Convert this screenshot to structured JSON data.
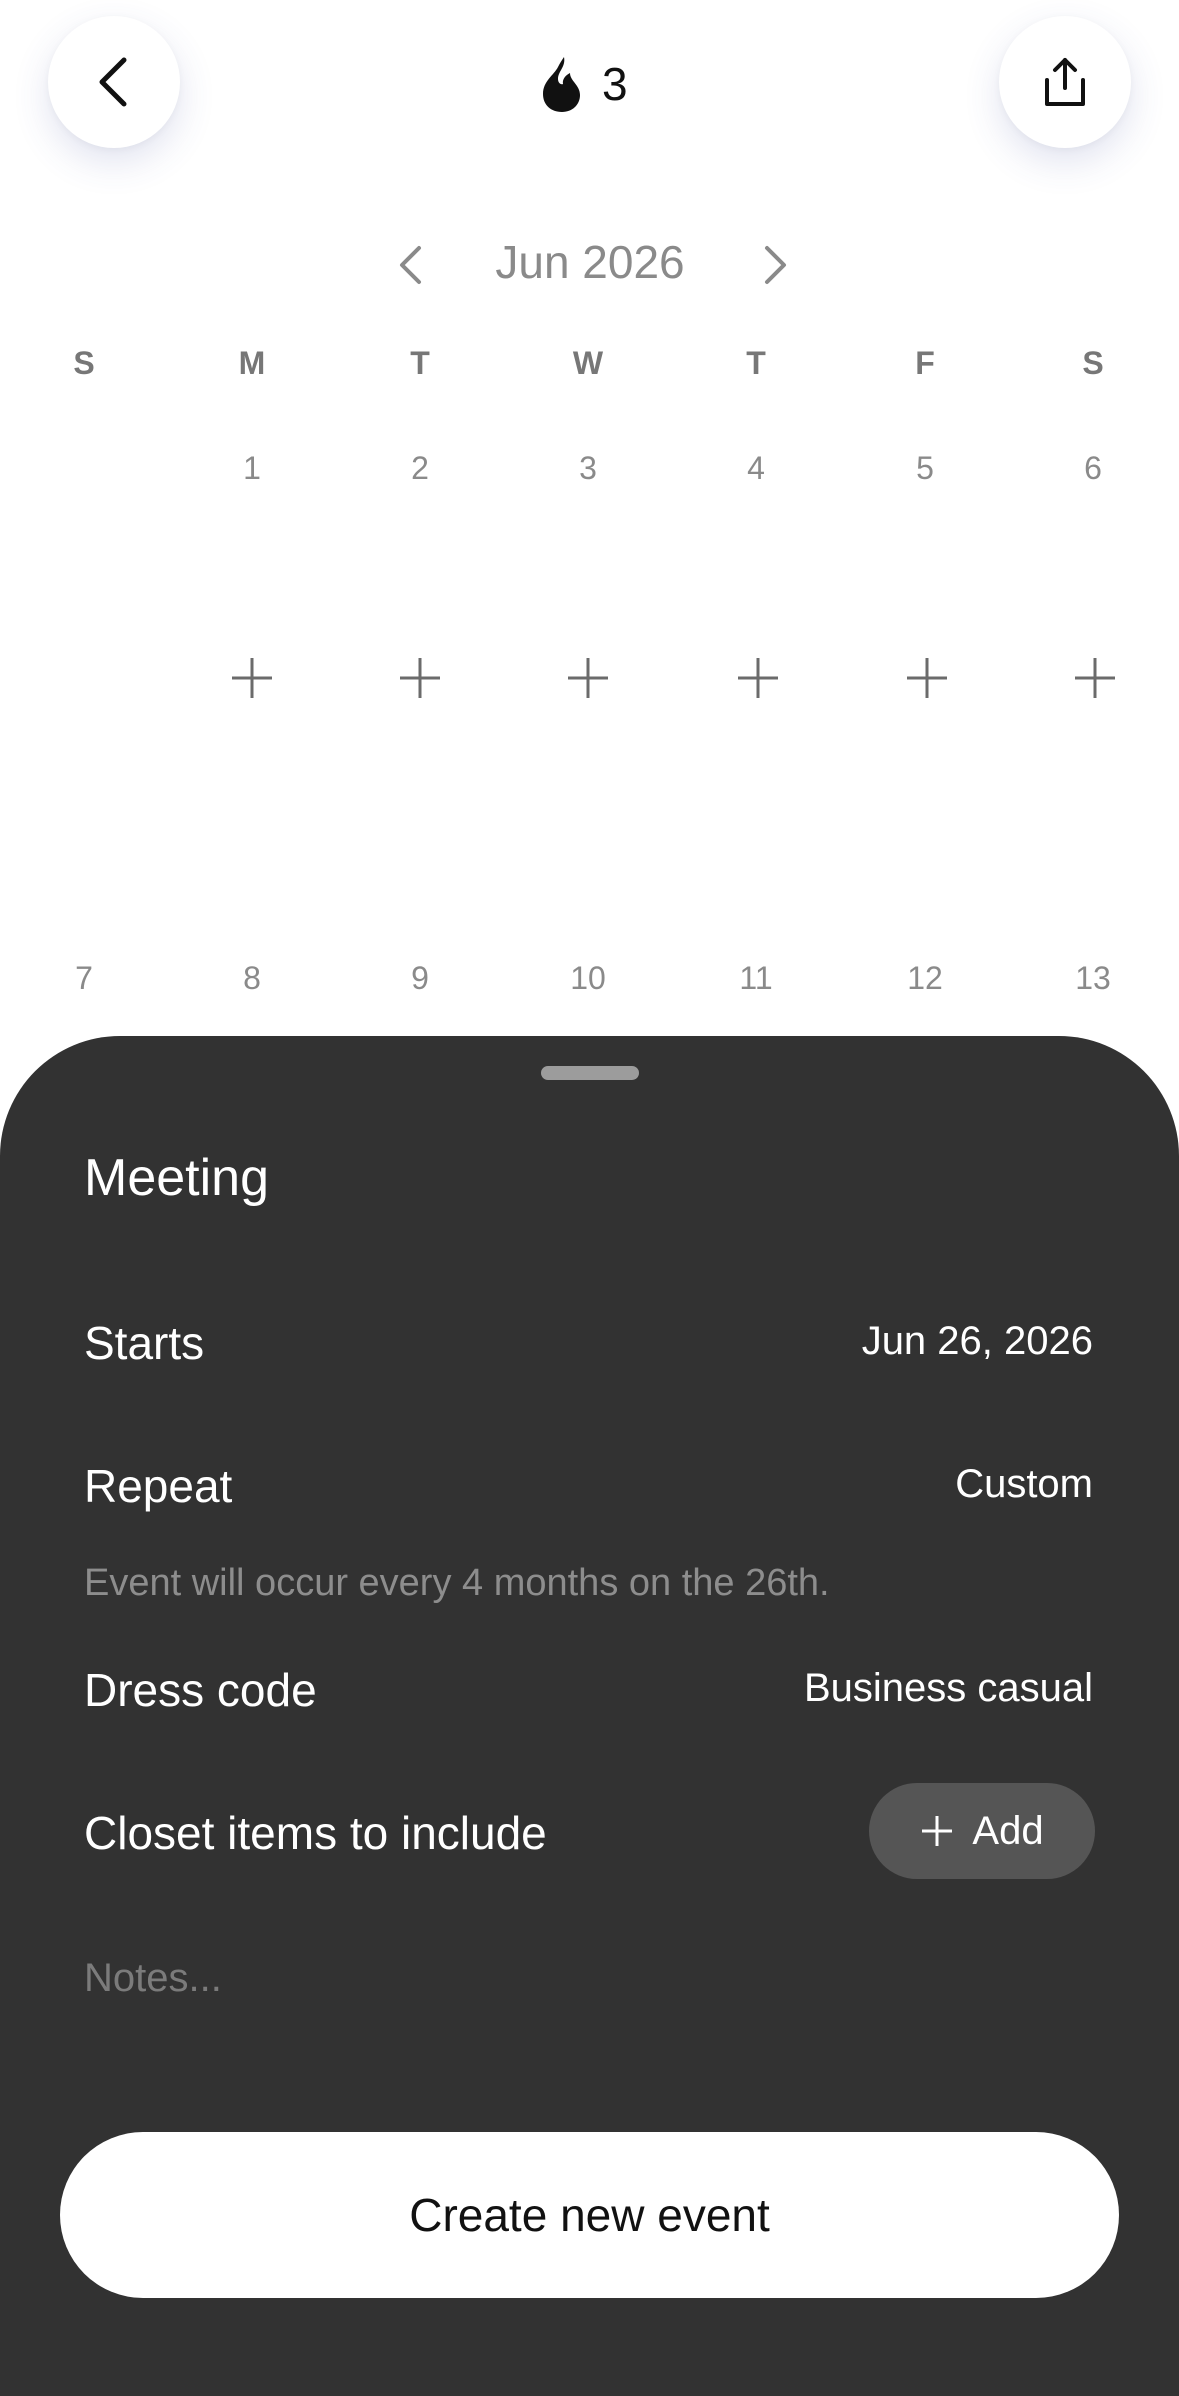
{
  "header": {
    "streak_count": "3",
    "icons": {
      "back": "chevron-left-icon",
      "streak": "flame-icon",
      "share": "share-icon"
    }
  },
  "calendar": {
    "month_label": "Jun 2026",
    "weekdays": [
      "S",
      "M",
      "T",
      "W",
      "T",
      "F",
      "S"
    ],
    "week1": [
      "",
      "1",
      "2",
      "3",
      "4",
      "5",
      "6"
    ],
    "week2": [
      "7",
      "8",
      "9",
      "10",
      "11",
      "12",
      "13"
    ]
  },
  "sheet": {
    "title": "Meeting",
    "starts_label": "Starts",
    "starts_value": "Jun 26, 2026",
    "repeat_label": "Repeat",
    "repeat_value": "Custom",
    "repeat_description": "Event will occur every 4 months on the 26th.",
    "dress_code_label": "Dress code",
    "dress_code_value": "Business casual",
    "closet_label": "Closet items to include",
    "add_label": "Add",
    "notes_placeholder": "Notes...",
    "create_label": "Create new event"
  },
  "colors": {
    "sheet_bg": "#323232",
    "add_button_bg": "#555555",
    "muted_text": "#8a8a8a"
  }
}
